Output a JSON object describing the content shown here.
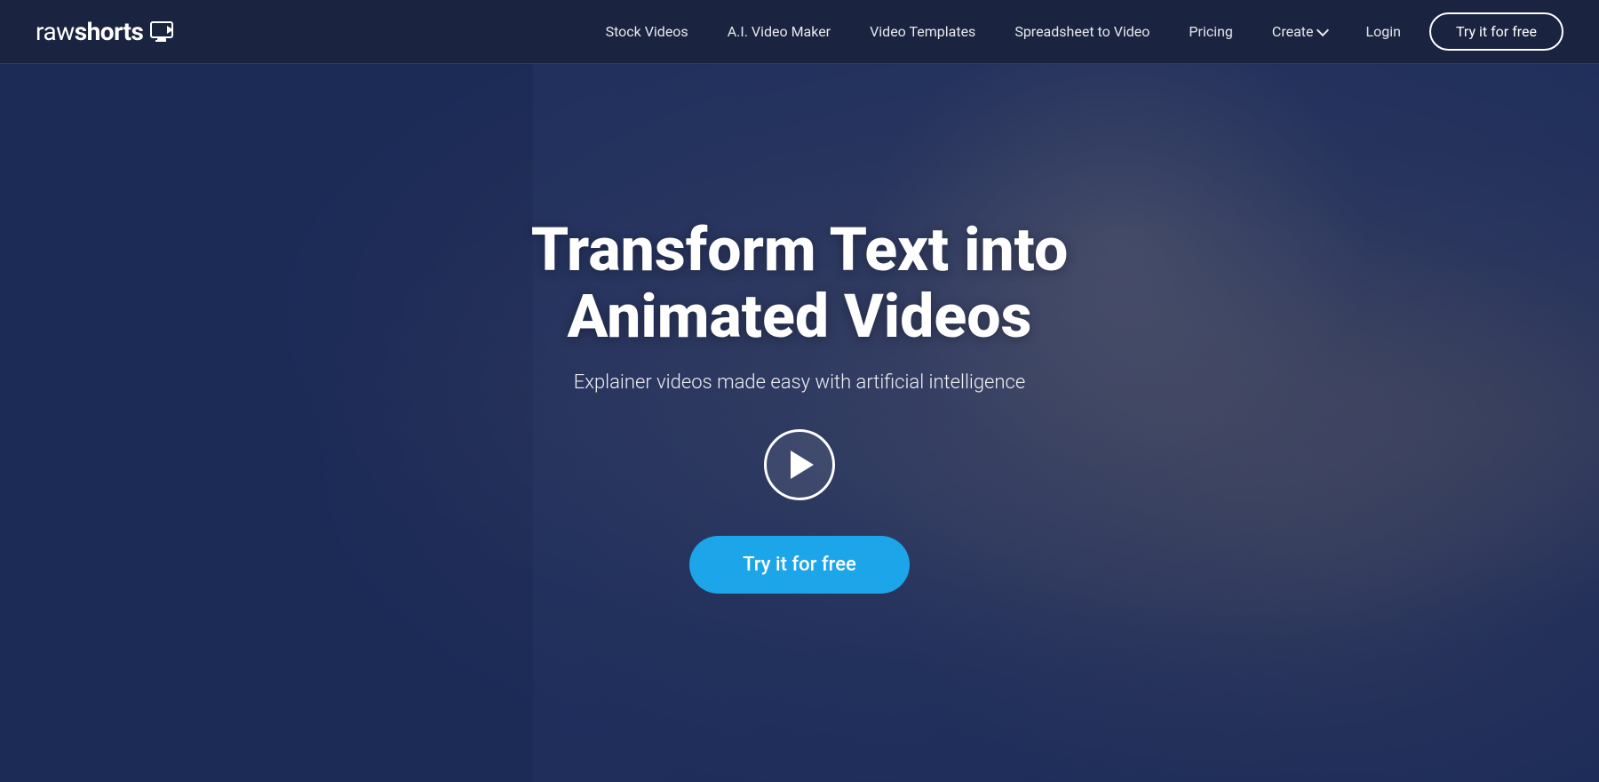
{
  "brand": {
    "name_part1": "raw",
    "name_part2": "shorts"
  },
  "nav": {
    "links": [
      {
        "id": "stock-videos",
        "label": "Stock Videos"
      },
      {
        "id": "ai-video-maker",
        "label": "A.I. Video Maker"
      },
      {
        "id": "video-templates",
        "label": "Video Templates"
      },
      {
        "id": "spreadsheet-to-video",
        "label": "Spreadsheet to Video"
      },
      {
        "id": "pricing",
        "label": "Pricing"
      },
      {
        "id": "create",
        "label": "Create"
      }
    ],
    "login_label": "Login",
    "cta_label": "Try it for free"
  },
  "hero": {
    "title": "Transform Text into Animated Videos",
    "subtitle": "Explainer videos made easy with artificial intelligence",
    "play_label": "Play video",
    "cta_label": "Try it for free"
  },
  "colors": {
    "nav_bg": "#1a2340",
    "hero_overlay": "rgba(20,35,80,0.62)",
    "cta_blue": "#1ca5e8",
    "white": "#ffffff"
  }
}
